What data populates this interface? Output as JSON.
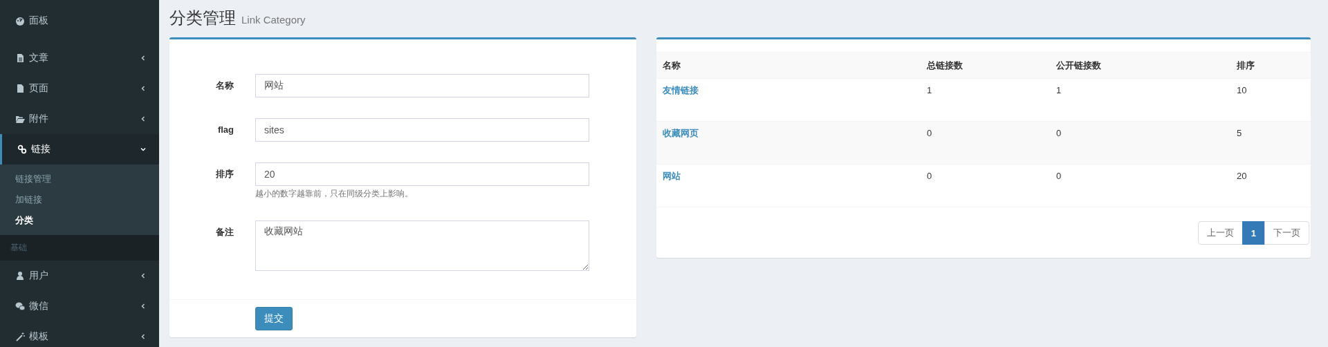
{
  "sidebar": {
    "items": [
      {
        "kind": "link",
        "label": "面板",
        "selected": false
      },
      {
        "kind": "menu",
        "label": "文章",
        "selected": false,
        "expanded": false
      },
      {
        "kind": "menu",
        "label": "页面",
        "selected": false,
        "expanded": false
      },
      {
        "kind": "menu",
        "label": "附件",
        "selected": false,
        "expanded": false
      },
      {
        "kind": "menu",
        "label": "链接",
        "selected": true,
        "expanded": true,
        "children": [
          {
            "label": "链接管理",
            "selected": false
          },
          {
            "label": "加链接",
            "selected": false
          },
          {
            "label": "分类",
            "selected": true
          }
        ]
      },
      {
        "kind": "header",
        "label": "基础"
      },
      {
        "kind": "menu",
        "label": "用户",
        "selected": false,
        "expanded": false
      },
      {
        "kind": "menu",
        "label": "微信",
        "selected": false,
        "expanded": false
      },
      {
        "kind": "menu",
        "label": "模板",
        "selected": false,
        "expanded": false
      }
    ]
  },
  "page": {
    "title": "分类管理",
    "subtitle": "Link Category"
  },
  "form": {
    "fields": [
      {
        "kind": "input",
        "label": "名称",
        "value": "网站"
      },
      {
        "kind": "input",
        "label": "flag",
        "value": "sites"
      },
      {
        "kind": "input",
        "label": "排序",
        "value": "20",
        "help": "越小的数字越靠前，只在同级分类上影响。"
      },
      {
        "kind": "textarea",
        "label": "备注",
        "value": "收藏网站"
      }
    ],
    "submit": "提交"
  },
  "table": {
    "columns": [
      "名称",
      "总链接数",
      "公开链接数",
      "排序"
    ],
    "rows": [
      [
        "友情链接",
        "1",
        "1",
        "10"
      ],
      [
        "收藏网页",
        "0",
        "0",
        "5"
      ],
      [
        "网站",
        "0",
        "0",
        "20"
      ]
    ],
    "pagination": {
      "prev": "上一页",
      "pages": [
        {
          "label": "1",
          "selected": true
        }
      ],
      "next": "下一页"
    }
  }
}
